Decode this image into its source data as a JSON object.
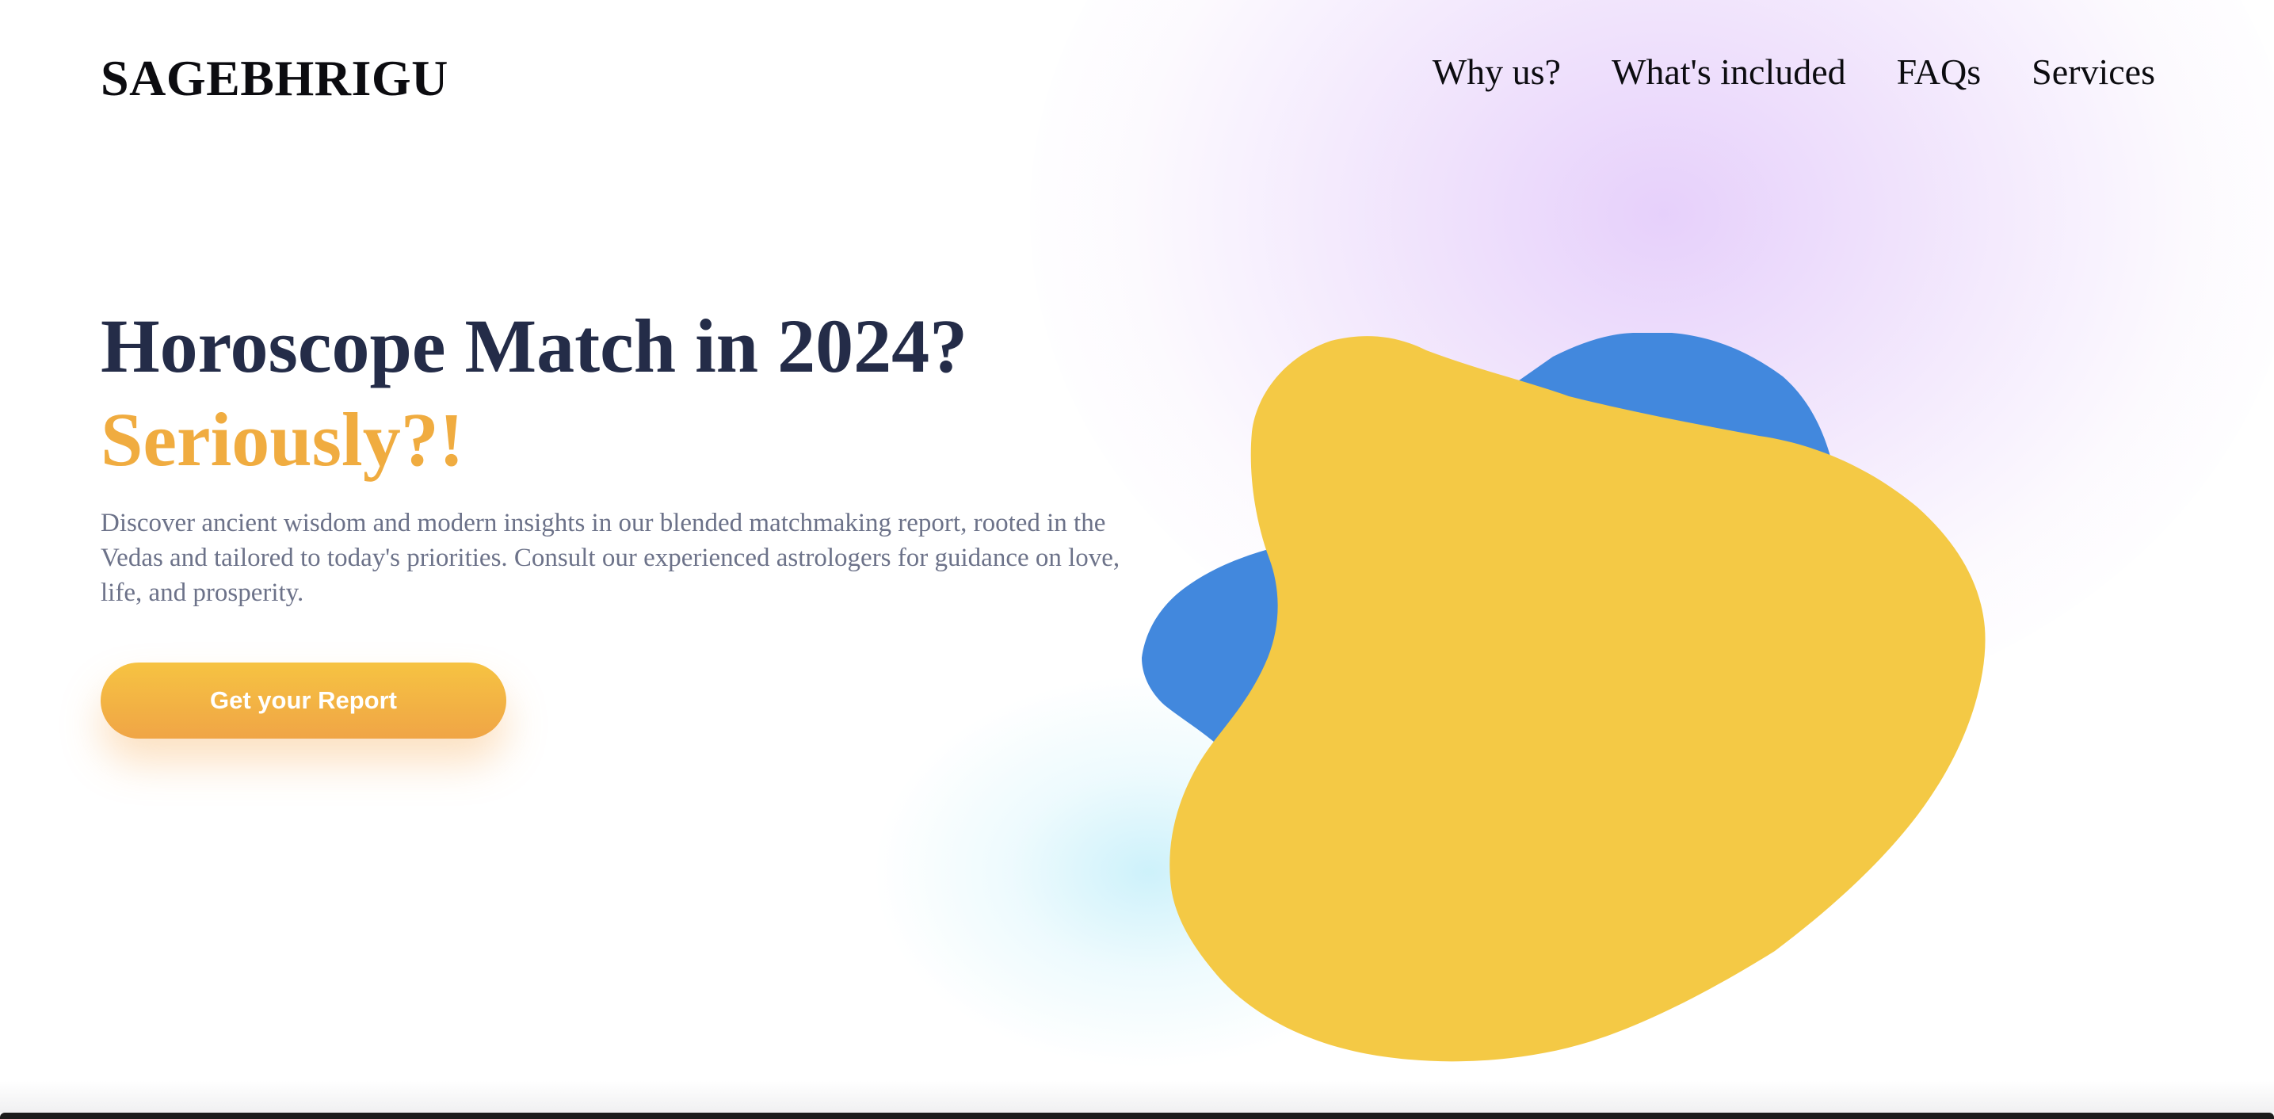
{
  "header": {
    "logo": "SAGEBHRIGU",
    "nav": [
      {
        "label": "Why us?"
      },
      {
        "label": "What's included"
      },
      {
        "label": "FAQs"
      },
      {
        "label": "Services"
      }
    ]
  },
  "hero": {
    "title_line1": "Horoscope Match in 2024?",
    "title_line2": "Seriously?!",
    "description": "Discover ancient wisdom and modern insights in our blended matchmaking report, rooted in the Vedas and tailored to today's priorities. Consult our experienced astrologers for guidance on love, life, and prosperity.",
    "cta_label": "Get your Report"
  },
  "colors": {
    "title": "#242c48",
    "accent_orange": "#f0ac40",
    "description": "#6c7289",
    "blob_yellow": "#f4c945",
    "blob_blue": "#4288dd",
    "glow_purple": "#e2c8fa",
    "glow_cyan": "#c8f0fa"
  }
}
